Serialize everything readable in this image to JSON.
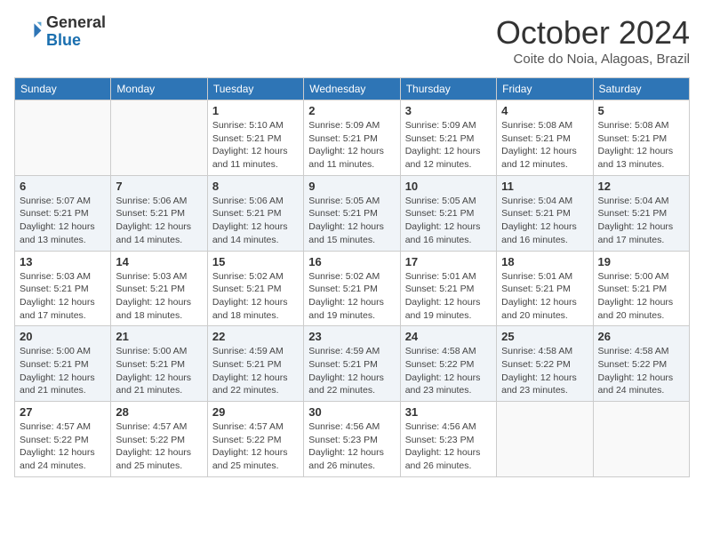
{
  "logo": {
    "general": "General",
    "blue": "Blue"
  },
  "title": "October 2024",
  "subtitle": "Coite do Noia, Alagoas, Brazil",
  "days_of_week": [
    "Sunday",
    "Monday",
    "Tuesday",
    "Wednesday",
    "Thursday",
    "Friday",
    "Saturday"
  ],
  "weeks": [
    [
      {
        "day": "",
        "info": ""
      },
      {
        "day": "",
        "info": ""
      },
      {
        "day": "1",
        "info": "Sunrise: 5:10 AM\nSunset: 5:21 PM\nDaylight: 12 hours\nand 11 minutes."
      },
      {
        "day": "2",
        "info": "Sunrise: 5:09 AM\nSunset: 5:21 PM\nDaylight: 12 hours\nand 11 minutes."
      },
      {
        "day": "3",
        "info": "Sunrise: 5:09 AM\nSunset: 5:21 PM\nDaylight: 12 hours\nand 12 minutes."
      },
      {
        "day": "4",
        "info": "Sunrise: 5:08 AM\nSunset: 5:21 PM\nDaylight: 12 hours\nand 12 minutes."
      },
      {
        "day": "5",
        "info": "Sunrise: 5:08 AM\nSunset: 5:21 PM\nDaylight: 12 hours\nand 13 minutes."
      }
    ],
    [
      {
        "day": "6",
        "info": "Sunrise: 5:07 AM\nSunset: 5:21 PM\nDaylight: 12 hours\nand 13 minutes."
      },
      {
        "day": "7",
        "info": "Sunrise: 5:06 AM\nSunset: 5:21 PM\nDaylight: 12 hours\nand 14 minutes."
      },
      {
        "day": "8",
        "info": "Sunrise: 5:06 AM\nSunset: 5:21 PM\nDaylight: 12 hours\nand 14 minutes."
      },
      {
        "day": "9",
        "info": "Sunrise: 5:05 AM\nSunset: 5:21 PM\nDaylight: 12 hours\nand 15 minutes."
      },
      {
        "day": "10",
        "info": "Sunrise: 5:05 AM\nSunset: 5:21 PM\nDaylight: 12 hours\nand 16 minutes."
      },
      {
        "day": "11",
        "info": "Sunrise: 5:04 AM\nSunset: 5:21 PM\nDaylight: 12 hours\nand 16 minutes."
      },
      {
        "day": "12",
        "info": "Sunrise: 5:04 AM\nSunset: 5:21 PM\nDaylight: 12 hours\nand 17 minutes."
      }
    ],
    [
      {
        "day": "13",
        "info": "Sunrise: 5:03 AM\nSunset: 5:21 PM\nDaylight: 12 hours\nand 17 minutes."
      },
      {
        "day": "14",
        "info": "Sunrise: 5:03 AM\nSunset: 5:21 PM\nDaylight: 12 hours\nand 18 minutes."
      },
      {
        "day": "15",
        "info": "Sunrise: 5:02 AM\nSunset: 5:21 PM\nDaylight: 12 hours\nand 18 minutes."
      },
      {
        "day": "16",
        "info": "Sunrise: 5:02 AM\nSunset: 5:21 PM\nDaylight: 12 hours\nand 19 minutes."
      },
      {
        "day": "17",
        "info": "Sunrise: 5:01 AM\nSunset: 5:21 PM\nDaylight: 12 hours\nand 19 minutes."
      },
      {
        "day": "18",
        "info": "Sunrise: 5:01 AM\nSunset: 5:21 PM\nDaylight: 12 hours\nand 20 minutes."
      },
      {
        "day": "19",
        "info": "Sunrise: 5:00 AM\nSunset: 5:21 PM\nDaylight: 12 hours\nand 20 minutes."
      }
    ],
    [
      {
        "day": "20",
        "info": "Sunrise: 5:00 AM\nSunset: 5:21 PM\nDaylight: 12 hours\nand 21 minutes."
      },
      {
        "day": "21",
        "info": "Sunrise: 5:00 AM\nSunset: 5:21 PM\nDaylight: 12 hours\nand 21 minutes."
      },
      {
        "day": "22",
        "info": "Sunrise: 4:59 AM\nSunset: 5:21 PM\nDaylight: 12 hours\nand 22 minutes."
      },
      {
        "day": "23",
        "info": "Sunrise: 4:59 AM\nSunset: 5:21 PM\nDaylight: 12 hours\nand 22 minutes."
      },
      {
        "day": "24",
        "info": "Sunrise: 4:58 AM\nSunset: 5:22 PM\nDaylight: 12 hours\nand 23 minutes."
      },
      {
        "day": "25",
        "info": "Sunrise: 4:58 AM\nSunset: 5:22 PM\nDaylight: 12 hours\nand 23 minutes."
      },
      {
        "day": "26",
        "info": "Sunrise: 4:58 AM\nSunset: 5:22 PM\nDaylight: 12 hours\nand 24 minutes."
      }
    ],
    [
      {
        "day": "27",
        "info": "Sunrise: 4:57 AM\nSunset: 5:22 PM\nDaylight: 12 hours\nand 24 minutes."
      },
      {
        "day": "28",
        "info": "Sunrise: 4:57 AM\nSunset: 5:22 PM\nDaylight: 12 hours\nand 25 minutes."
      },
      {
        "day": "29",
        "info": "Sunrise: 4:57 AM\nSunset: 5:22 PM\nDaylight: 12 hours\nand 25 minutes."
      },
      {
        "day": "30",
        "info": "Sunrise: 4:56 AM\nSunset: 5:23 PM\nDaylight: 12 hours\nand 26 minutes."
      },
      {
        "day": "31",
        "info": "Sunrise: 4:56 AM\nSunset: 5:23 PM\nDaylight: 12 hours\nand 26 minutes."
      },
      {
        "day": "",
        "info": ""
      },
      {
        "day": "",
        "info": ""
      }
    ]
  ]
}
